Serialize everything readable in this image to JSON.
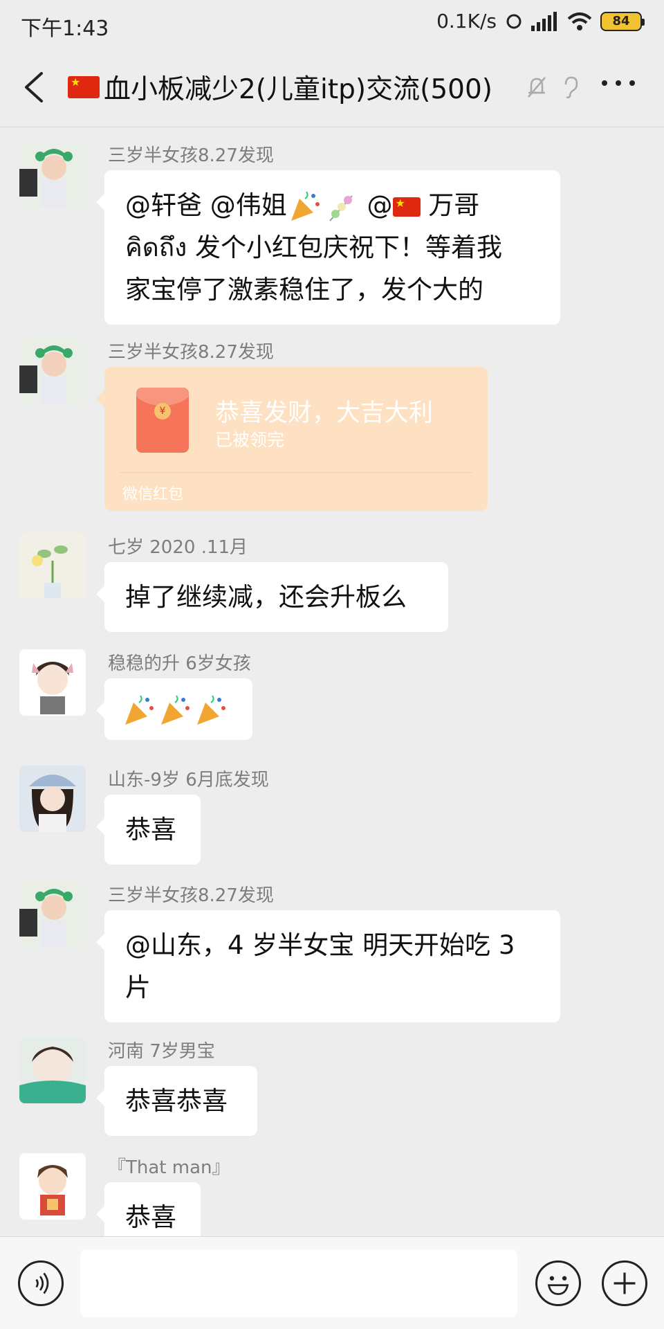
{
  "status_bar": {
    "time": "下午1:43",
    "network_speed": "0.1K/s",
    "battery": "84"
  },
  "header": {
    "title": "血小板减少2(儿童itp)交流(500)"
  },
  "messages": [
    {
      "sender": "三岁半女孩8.27发现",
      "text_a": "@轩爸 @伟姐",
      "text_b": " @",
      "text_c": " 万哥",
      "text_d": "คิดถึง 发个小红包庆祝下！等着我",
      "text_e": "家宝停了激素稳住了，发个大的"
    },
    {
      "sender": "三岁半女孩8.27发现",
      "red_packet": {
        "title": "恭喜发财，大吉大利",
        "status": "已被领完",
        "footer": "微信红包"
      }
    },
    {
      "sender": "七岁 2020  .11月",
      "text": "掉了继续减，还会升板么"
    },
    {
      "sender": "稳稳的升 6岁女孩"
    },
    {
      "sender": "山东-9岁 6月底发现",
      "text": "恭喜"
    },
    {
      "sender": "三岁半女孩8.27发现",
      "text_a": "@山东，4 岁半女宝  明天开始吃 3",
      "text_b": "片"
    },
    {
      "sender": "河南  7岁男宝",
      "text": "恭喜恭喜"
    },
    {
      "sender": "『That man』",
      "text": "恭喜"
    }
  ],
  "colors": {
    "background": "#ededed",
    "bubble": "#ffffff",
    "red_packet": "#fde1c2",
    "accent_red": "#f5745a"
  },
  "icons": [
    "back-arrow-icon",
    "flag-icon",
    "mute-bell-icon",
    "ear-icon",
    "more-icon",
    "voice-icon",
    "emoji-icon",
    "plus-icon",
    "party-popper-icon"
  ]
}
